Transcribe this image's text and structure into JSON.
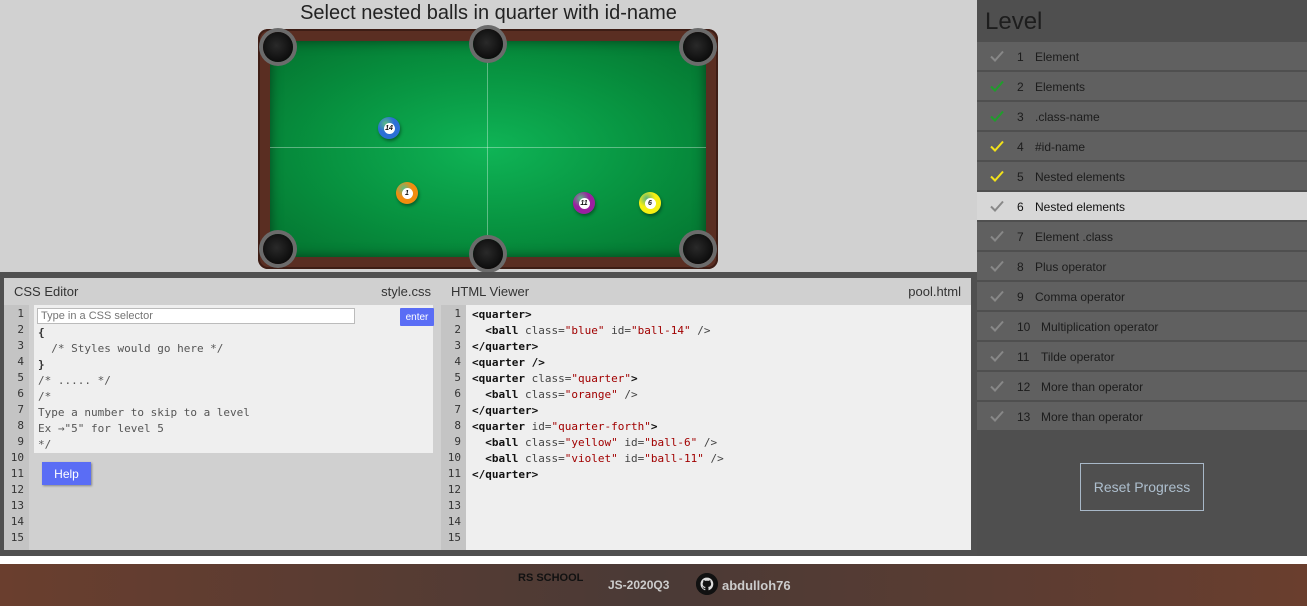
{
  "task": {
    "title": "Select nested balls in quarter with id-name"
  },
  "balls": [
    {
      "number": "14",
      "color": "#2b6fd6"
    },
    {
      "number": "1",
      "color": "#f28c0f"
    },
    {
      "number": "11",
      "color": "#9b1fa0"
    },
    {
      "number": "6",
      "color": "#f5f012"
    }
  ],
  "css_editor": {
    "title": "CSS Editor",
    "filename": "style.css",
    "input_placeholder": "Type in a CSS selector",
    "enter_label": "enter",
    "code": [
      "{",
      "  /* Styles would go here */",
      "}",
      "/* ..... */",
      "/*",
      "Type a number to skip to a level",
      "Ex →\"5\" for level 5",
      "*/"
    ],
    "line_numbers": [
      "1",
      "2",
      "3",
      "4",
      "5",
      "6",
      "7",
      "8",
      "9",
      "10",
      "11",
      "12",
      "13",
      "14",
      "15"
    ],
    "help_label": "Help"
  },
  "html_viewer": {
    "title": "HTML Viewer",
    "filename": "pool.html",
    "line_numbers": [
      "1",
      "2",
      "3",
      "4",
      "5",
      "6",
      "7",
      "8",
      "9",
      "10",
      "11",
      "12",
      "13",
      "14",
      "15"
    ],
    "lines": [
      [
        {
          "t": "tag",
          "v": "<quarter>"
        }
      ],
      [
        {
          "t": "text",
          "v": "  "
        },
        {
          "t": "tag",
          "v": "<ball"
        },
        {
          "t": "attr",
          "v": " class="
        },
        {
          "t": "val",
          "v": "\"blue\""
        },
        {
          "t": "attr",
          "v": " id="
        },
        {
          "t": "val",
          "v": "\"ball-14\""
        },
        {
          "t": "attr",
          "v": " />"
        }
      ],
      [
        {
          "t": "tag",
          "v": "</quarter>"
        }
      ],
      [
        {
          "t": "tag",
          "v": "<quarter />"
        }
      ],
      [
        {
          "t": "tag",
          "v": "<quarter"
        },
        {
          "t": "attr",
          "v": " class="
        },
        {
          "t": "val",
          "v": "\"quarter\""
        },
        {
          "t": "tag",
          "v": ">"
        }
      ],
      [
        {
          "t": "text",
          "v": "  "
        },
        {
          "t": "tag",
          "v": "<ball"
        },
        {
          "t": "attr",
          "v": " class="
        },
        {
          "t": "val",
          "v": "\"orange\""
        },
        {
          "t": "attr",
          "v": " />"
        }
      ],
      [
        {
          "t": "tag",
          "v": "</quarter>"
        }
      ],
      [
        {
          "t": "tag",
          "v": "<quarter"
        },
        {
          "t": "attr",
          "v": " id="
        },
        {
          "t": "val",
          "v": "\"quarter-forth\""
        },
        {
          "t": "tag",
          "v": ">"
        }
      ],
      [
        {
          "t": "text",
          "v": "  "
        },
        {
          "t": "tag",
          "v": "<ball"
        },
        {
          "t": "attr",
          "v": " class="
        },
        {
          "t": "val",
          "v": "\"yellow\""
        },
        {
          "t": "attr",
          "v": " id="
        },
        {
          "t": "val",
          "v": "\"ball-6\""
        },
        {
          "t": "attr",
          "v": " />"
        }
      ],
      [
        {
          "t": "text",
          "v": "  "
        },
        {
          "t": "tag",
          "v": "<ball"
        },
        {
          "t": "attr",
          "v": " class="
        },
        {
          "t": "val",
          "v": "\"violet\""
        },
        {
          "t": "attr",
          "v": " id="
        },
        {
          "t": "val",
          "v": "\"ball-11\""
        },
        {
          "t": "attr",
          "v": " />"
        }
      ],
      [
        {
          "t": "tag",
          "v": "</quarter>"
        }
      ]
    ]
  },
  "sidebar": {
    "title": "Level",
    "levels": [
      {
        "num": "1",
        "name": "Element",
        "check": "#888888",
        "active": false
      },
      {
        "num": "2",
        "name": "Elements",
        "check": "#1f9e2b",
        "active": false
      },
      {
        "num": "3",
        "name": ".class-name",
        "check": "#1f9e2b",
        "active": false
      },
      {
        "num": "4",
        "name": "#id-name",
        "check": "#f2e21a",
        "active": false
      },
      {
        "num": "5",
        "name": "Nested elements",
        "check": "#f2e21a",
        "active": false
      },
      {
        "num": "6",
        "name": "Nested elements",
        "check": "#888888",
        "active": true
      },
      {
        "num": "7",
        "name": "Element .class",
        "check": "#888888",
        "active": false
      },
      {
        "num": "8",
        "name": "Plus operator",
        "check": "#888888",
        "active": false
      },
      {
        "num": "9",
        "name": "Comma operator",
        "check": "#888888",
        "active": false
      },
      {
        "num": "10",
        "name": "Multiplication operator",
        "check": "#888888",
        "active": false
      },
      {
        "num": "11",
        "name": "Tilde operator",
        "check": "#888888",
        "active": false
      },
      {
        "num": "12",
        "name": "More than operator",
        "check": "#888888",
        "active": false
      },
      {
        "num": "13",
        "name": "More than operator",
        "check": "#888888",
        "active": false
      }
    ],
    "reset_label": "Reset Progress"
  },
  "footer": {
    "logo_text": "RS SCHOOL",
    "course": "JS-2020Q3",
    "github_user": "abdulloh76"
  }
}
